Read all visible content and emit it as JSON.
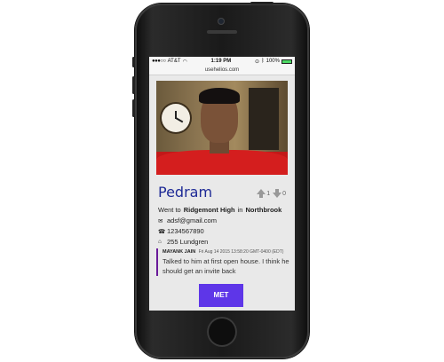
{
  "status_bar": {
    "carrier": "AT&T",
    "time": "1:19 PM",
    "battery": "100%"
  },
  "url_bar": {
    "url": "usehelios.com"
  },
  "profile": {
    "name": "Pedram",
    "upvotes": "1",
    "downvotes": "0",
    "school_prefix": "Went to",
    "school": "Ridgemont High",
    "school_in": "in",
    "city": "Northbrook",
    "email": "adsf@gmail.com",
    "phone": "1234567890",
    "address": "255 Lundgren"
  },
  "note": {
    "author": "MAYANK JAIN",
    "timestamp": "Fri Aug 14 2015 13:58:20 GMT-0400 (EDT)",
    "text": "Talked to him at first open house. I think he should get an invite back"
  },
  "actions": {
    "met_label": "MET"
  },
  "colors": {
    "name_color": "#1e2a96",
    "met_button": "#5e36e8",
    "note_accent": "#6a1a9a"
  },
  "icons": {
    "email": "envelope-icon",
    "phone": "phone-icon",
    "address": "home-icon"
  }
}
